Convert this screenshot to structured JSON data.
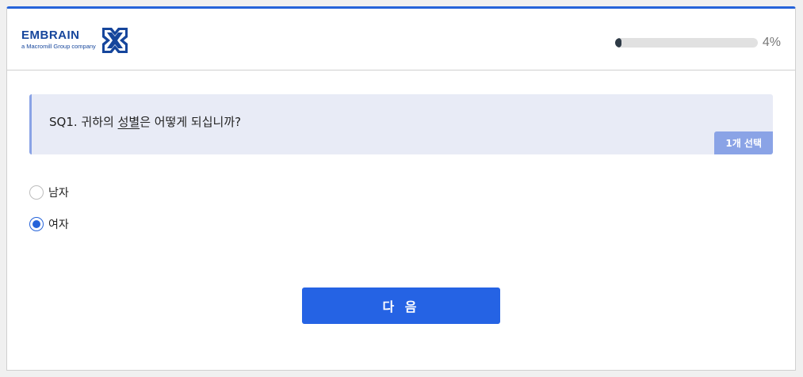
{
  "brand": {
    "name": "EMBRAIN",
    "tagline": "a Macromill Group company",
    "logo_icon": "embrain-x-mark-icon",
    "color": "#16469c"
  },
  "progress": {
    "percent_label": "4%",
    "value": 0.04,
    "fill_color": "#2e3a46"
  },
  "question": {
    "prefix": "SQ1. 귀하의 ",
    "highlight": "성별",
    "suffix": "은 어떻게 되십니까?",
    "badge": "1개 선택"
  },
  "options": [
    {
      "label": "남자",
      "checked": false
    },
    {
      "label": "여자",
      "checked": true
    }
  ],
  "next_button": {
    "label": "다 음",
    "color": "#2563e4"
  },
  "accent_color": "#2563d9"
}
